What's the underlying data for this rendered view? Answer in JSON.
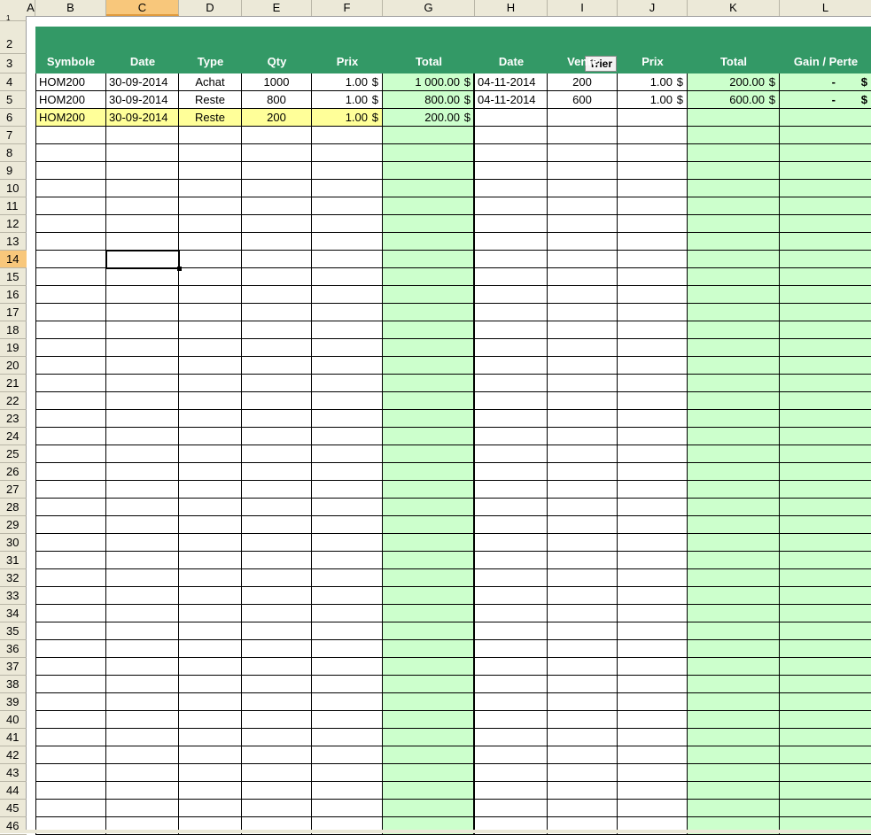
{
  "columns": [
    {
      "letter": "A",
      "w": 10
    },
    {
      "letter": "B",
      "w": 80
    },
    {
      "letter": "C",
      "w": 82,
      "selected": true
    },
    {
      "letter": "D",
      "w": 71
    },
    {
      "letter": "E",
      "w": 79
    },
    {
      "letter": "F",
      "w": 80
    },
    {
      "letter": "G",
      "w": 104
    },
    {
      "letter": "H",
      "w": 82
    },
    {
      "letter": "I",
      "w": 79
    },
    {
      "letter": "J",
      "w": 79
    },
    {
      "letter": "K",
      "w": 104
    },
    {
      "letter": "L",
      "w": 104
    }
  ],
  "header_labels": [
    "Symbole",
    "Date",
    "Type",
    "Qty",
    "Prix",
    "Total",
    "Date",
    "Vente",
    "Prix",
    "Total",
    "Gain / Perte"
  ],
  "trier_label": "Trier",
  "row_numbers": [
    "1",
    "2",
    "3",
    "4",
    "5",
    "6",
    "7",
    "8",
    "9",
    "10",
    "11",
    "12",
    "13",
    "14",
    "15",
    "16",
    "17",
    "18",
    "19",
    "20",
    "21",
    "22",
    "23",
    "24",
    "25",
    "26",
    "27",
    "28",
    "29",
    "30",
    "31",
    "32",
    "33",
    "34",
    "35",
    "36",
    "37",
    "38",
    "39",
    "40",
    "41",
    "42",
    "43",
    "44",
    "45",
    "46"
  ],
  "selected_row": "14",
  "rows": [
    {
      "symbole": "HOM200",
      "date": "30-09-2014",
      "type": "Achat",
      "qty": "1000",
      "prix": "1.00",
      "total": "1 000.00",
      "vdate": "04-11-2014",
      "vente": "200",
      "vprix": "1.00",
      "vtotal": "200.00",
      "gain": "-",
      "highlight": false
    },
    {
      "symbole": "HOM200",
      "date": "30-09-2014",
      "type": "Reste",
      "qty": "800",
      "prix": "1.00",
      "total": "800.00",
      "vdate": "04-11-2014",
      "vente": "600",
      "vprix": "1.00",
      "vtotal": "600.00",
      "gain": "-",
      "highlight": false
    },
    {
      "symbole": "HOM200",
      "date": "30-09-2014",
      "type": "Reste",
      "qty": "200",
      "prix": "1.00",
      "total": "200.00",
      "vdate": "",
      "vente": "",
      "vprix": "",
      "vtotal": "",
      "gain": "",
      "highlight": true
    }
  ],
  "currency": "$",
  "colors": {
    "band": "#339966",
    "green_fill": "#ccffcc",
    "yellow_fill": "#ffff99",
    "header_bg": "#ece9d8",
    "selection": "#f8c77b"
  }
}
